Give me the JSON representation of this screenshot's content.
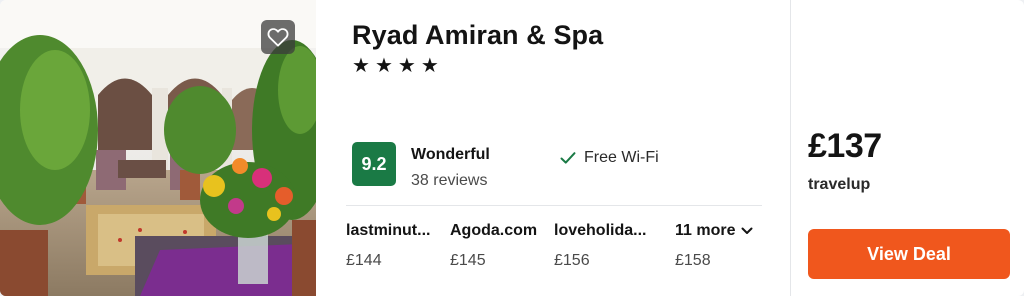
{
  "hotel": {
    "name": "Ryad Amiran & Spa",
    "stars": [
      "★",
      "★",
      "★",
      "★"
    ],
    "rating_score": "9.2",
    "rating_label": "Wonderful",
    "reviews": "38 reviews",
    "amenity": "Free Wi-Fi"
  },
  "providers": [
    {
      "name": "lastminut...",
      "price": "£144"
    },
    {
      "name": "Agoda.com",
      "price": "£145"
    },
    {
      "name": "loveholida...",
      "price": "£156"
    }
  ],
  "more": {
    "label": "11 more",
    "price": "£158"
  },
  "deal": {
    "price": "£137",
    "source": "travelup",
    "button_label": "View Deal"
  },
  "colors": {
    "rating_badge": "#1a7a45",
    "deal_button": "#f0571d"
  },
  "icons": {
    "favorite": "heart-icon",
    "amenity": "check-icon",
    "more": "chevron-down-icon"
  }
}
